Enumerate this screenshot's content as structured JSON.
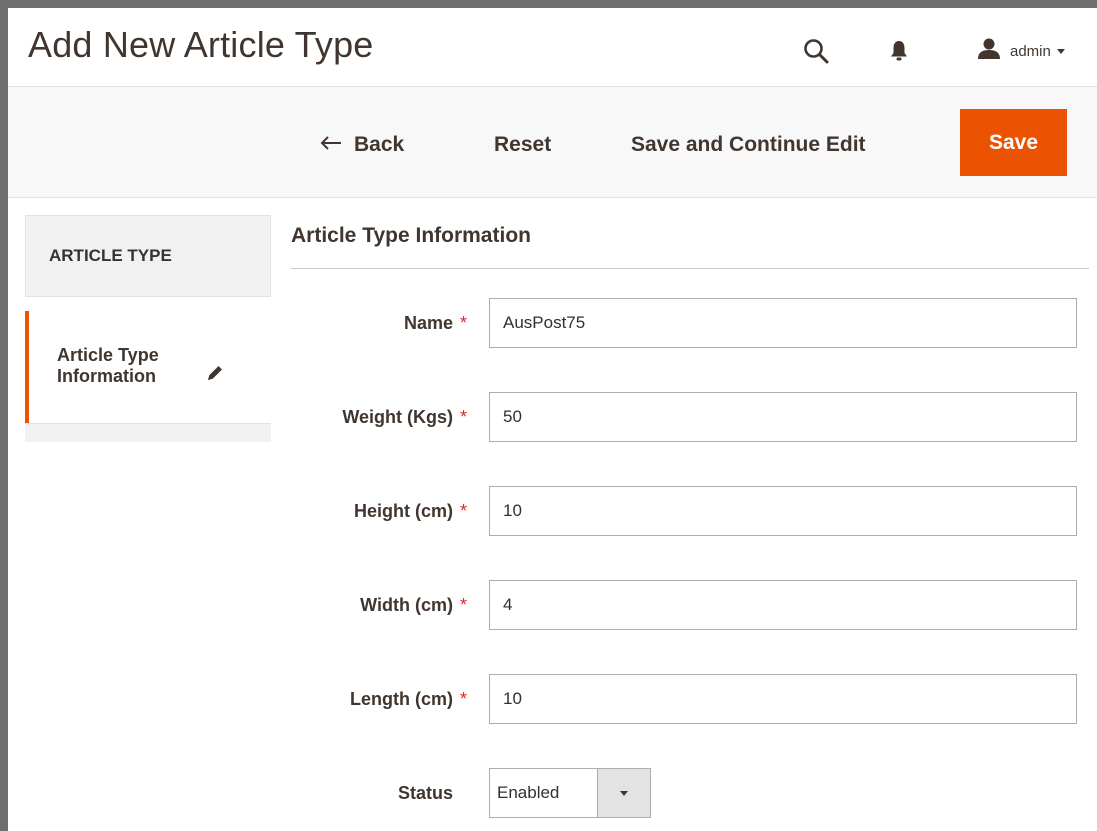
{
  "header": {
    "title": "Add New Article Type",
    "user_name": "admin",
    "icons": [
      "search-icon",
      "bell-icon",
      "user-icon",
      "chevron-down-icon"
    ]
  },
  "actions": {
    "back_label": "Back",
    "reset_label": "Reset",
    "save_continue_label": "Save and Continue Edit",
    "save_label": "Save"
  },
  "sidebar": {
    "title": "ARTICLE TYPE",
    "items": [
      {
        "label": "Article Type Information",
        "icon": "pencil-icon"
      }
    ]
  },
  "form": {
    "section_title": "Article Type Information",
    "fields": [
      {
        "label": "Name",
        "value": "AusPost75",
        "required": true
      },
      {
        "label": "Weight (Kgs)",
        "value": "50",
        "required": true
      },
      {
        "label": "Height (cm)",
        "value": "10",
        "required": true
      },
      {
        "label": "Width (cm)",
        "value": "4",
        "required": true
      },
      {
        "label": "Length (cm)",
        "value": "10",
        "required": true
      }
    ],
    "status": {
      "label": "Status",
      "value": "Enabled"
    },
    "required_marker": "*"
  },
  "colors": {
    "accent": "#eb5202",
    "required": "#e22626",
    "text": "#41362f",
    "panel_bg": "#f8f8f8"
  }
}
